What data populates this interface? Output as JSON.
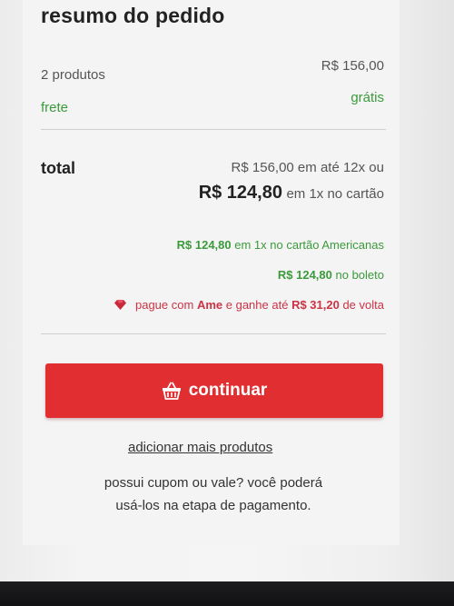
{
  "summary": {
    "title": "resumo do pedido",
    "products_label": "2 produtos",
    "products_value": "R$ 156,00",
    "shipping_label": "frete",
    "shipping_value": "grátis"
  },
  "total": {
    "label": "total",
    "installments": "R$ 156,00 em até 12x ou",
    "card_price": "R$ 124,80",
    "card_suffix": "em 1x no cartão"
  },
  "promos": {
    "americanas_price": "R$ 124,80",
    "americanas_text": "em 1x no cartão Americanas",
    "boleto_price": "R$ 124,80",
    "boleto_text": "no boleto",
    "ame_prefix": "pague com",
    "ame_brand": "Ame",
    "ame_middle": "e ganhe até",
    "ame_cashback": "R$ 31,20",
    "ame_suffix": "de volta",
    "ame_icon": "ruby-gem-icon"
  },
  "actions": {
    "continue_label": "continuar",
    "continue_icon": "shopping-basket-icon",
    "add_more_label": "adicionar mais produtos"
  },
  "coupon": {
    "line1": "possui cupom ou vale? você poderá",
    "line2": "usá-los na etapa de pagamento."
  },
  "colors": {
    "accent_red": "#e12f31",
    "green": "#3b9a3b",
    "ame_pink": "#cc3344"
  }
}
